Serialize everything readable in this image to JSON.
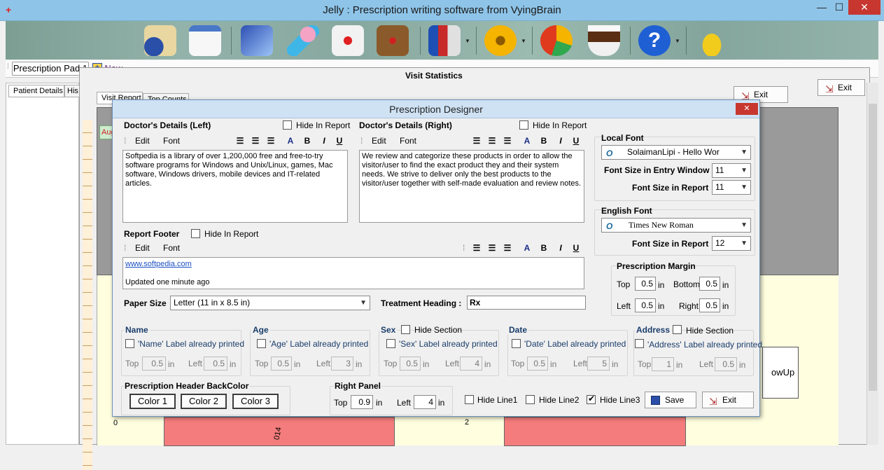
{
  "window": {
    "title": "Jelly : Prescription writing software from VyingBrain",
    "min": "—",
    "max": "☐",
    "close": "✕"
  },
  "tabs": {
    "pad": "Prescription Pad 1",
    "new": "New"
  },
  "left_tabs": [
    "Patient Details",
    "His"
  ],
  "bg": {
    "heading": "Visit Statistics",
    "tab1": "Visit Report",
    "tab2": "Top Counts",
    "exit1": "Exit",
    "exit2": "Exit",
    "aug": "Aug",
    "followup": "owUp",
    "axis0": "0",
    "axis2": "2",
    "rot": "014"
  },
  "dialog": {
    "title": "Prescription Designer",
    "close": "✕",
    "left": {
      "title": "Doctor's Details (Left)",
      "hide": "Hide In Report",
      "edit": "Edit",
      "font": "Font",
      "text": "Softpedia is a library of over 1,200,000 free and free-to-try software programs for Windows and Unix/Linux, games, Mac software, Windows drivers, mobile devices and IT-related articles."
    },
    "right": {
      "title": "Doctor's Details (Right)",
      "hide": "Hide In Report",
      "edit": "Edit",
      "font": "Font",
      "text": "We review and categorize these products in order to allow the visitor/user to find the exact product they and their system needs. We strive to deliver only the best products to the visitor/user together with self-made evaluation and review notes."
    },
    "footer": {
      "title": "Report Footer",
      "hide": "Hide In Report",
      "edit": "Edit",
      "font": "Font",
      "link": "www.softpedia.com",
      "line2": "Updated one minute ago"
    },
    "fmt": {
      "bold": "B",
      "italic": "I",
      "underline": "U",
      "color": "A"
    },
    "local_font": {
      "title": "Local Font",
      "value": "SolaimanLipi   - Hello Wor",
      "size_entry_label": "Font Size in Entry Window",
      "size_entry": "11",
      "size_report_label": "Font Size in Report",
      "size_report": "11"
    },
    "english_font": {
      "title": "English Font",
      "value": "Times New Roman",
      "size_report_label": "Font Size in Report",
      "size_report": "12"
    },
    "margin": {
      "title": "Prescription Margin",
      "top_label": "Top",
      "top": "0.5",
      "bottom_label": "Bottom",
      "bottom": "0.5",
      "left_label": "Left",
      "left": "0.5",
      "right_label": "Right",
      "right": "0.5",
      "unit": "in"
    },
    "paper": {
      "label": "Paper Size",
      "value": "Letter (11 in x 8.5 in)"
    },
    "treatment": {
      "label": "Treatment Heading :",
      "value": "Rx"
    },
    "fields": [
      {
        "title": "Name",
        "check": "'Name' Label already printed",
        "top": "0.5",
        "left": "0.5",
        "hide": ""
      },
      {
        "title": "Age",
        "check": "'Age' Label already printed",
        "top": "0.5",
        "left": "3",
        "hide": ""
      },
      {
        "title": "Sex",
        "check": "'Sex' Label already printed",
        "top": "0.5",
        "left": "4",
        "hide": "Hide Section"
      },
      {
        "title": "Date",
        "check": "'Date' Label already printed",
        "top": "0.5",
        "left": "5",
        "hide": ""
      },
      {
        "title": "Address",
        "check": "'Address' Label already printed",
        "top": "1",
        "left": "0.5",
        "hide": "Hide Section"
      }
    ],
    "labels": {
      "top": "Top",
      "left": "Left",
      "unit": "in"
    },
    "header_color": {
      "title": "Prescription Header BackColor",
      "c1": "Color 1",
      "c2": "Color 2",
      "c3": "Color 3"
    },
    "right_panel": {
      "title": "Right Panel",
      "top_label": "Top",
      "top": "0.9",
      "left_label": "Left",
      "left": "4",
      "unit": "in"
    },
    "hide_lines": {
      "l1": "Hide Line1",
      "l2": "Hide Line2",
      "l3": "Hide Line3"
    },
    "buttons": {
      "save": "Save",
      "exit": "Exit"
    }
  },
  "colors": {
    "toolbar": "#8aaba1",
    "title_bg": "#8ec4e8",
    "chart_bar": "#f47c7c",
    "chart_bg": "#ffffe0"
  }
}
